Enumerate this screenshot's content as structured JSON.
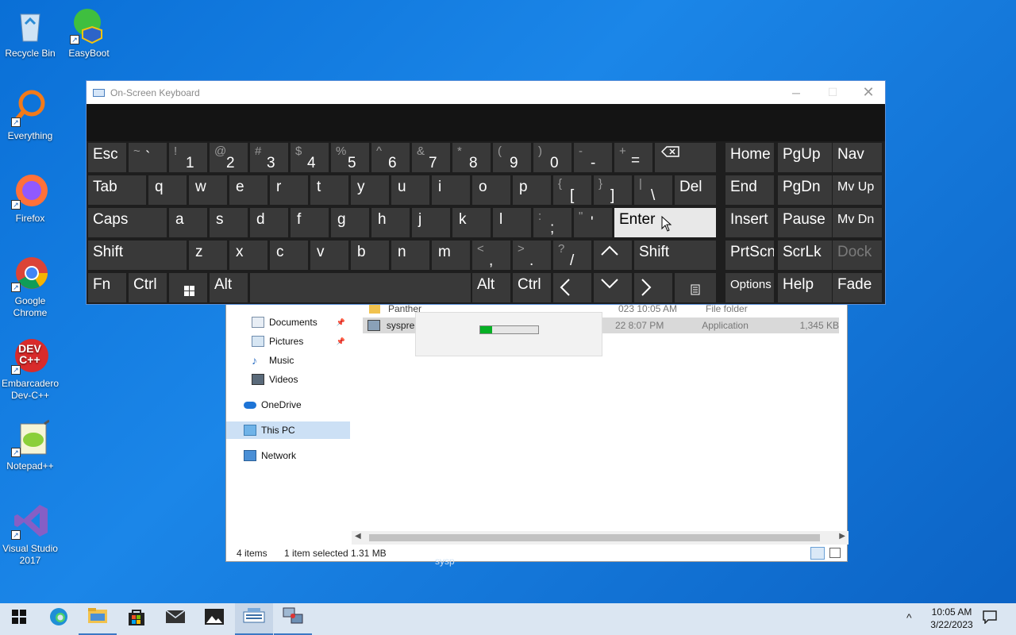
{
  "desktop": {
    "icons": [
      {
        "label": "Recycle Bin",
        "icon": "recycle-bin-icon"
      },
      {
        "label": "EasyBoot",
        "icon": "easyboot-icon"
      },
      {
        "label": "Everything",
        "icon": "everything-search-icon"
      },
      {
        "label": "Firefox",
        "icon": "firefox-icon"
      },
      {
        "label": "Google Chrome",
        "icon": "chrome-icon"
      },
      {
        "label": "Embarcadero Dev-C++",
        "icon": "devcpp-icon"
      },
      {
        "label": "Notepad++",
        "icon": "notepadpp-icon"
      },
      {
        "label": "Visual Studio 2017",
        "icon": "visual-studio-icon"
      }
    ]
  },
  "osk": {
    "title": "On-Screen Keyboard",
    "rows": {
      "r1": [
        "Esc",
        "~",
        "`",
        "!",
        "1",
        "@",
        "2",
        "#",
        "3",
        "$",
        "4",
        "%",
        "5",
        "^",
        "6",
        "&",
        "7",
        "*",
        "8",
        "(",
        "9",
        ")",
        "0",
        "-",
        "-",
        "+",
        "=",
        "Home",
        "PgUp",
        "Nav"
      ],
      "r2": [
        "Tab",
        "q",
        "w",
        "e",
        "r",
        "t",
        "y",
        "u",
        "i",
        "o",
        "p",
        "{",
        "[",
        "}",
        "]",
        "|",
        "\\",
        "Del",
        "End",
        "PgDn",
        "Mv Up"
      ],
      "r3": [
        "Caps",
        "a",
        "s",
        "d",
        "f",
        "g",
        "h",
        "j",
        "k",
        "l",
        ":",
        ";",
        "\"",
        "'",
        "Enter",
        "Insert",
        "Pause",
        "Mv Dn"
      ],
      "r4": [
        "Shift",
        "z",
        "x",
        "c",
        "v",
        "b",
        "n",
        "m",
        "<",
        ",",
        ">",
        ".",
        "?",
        "/",
        "Shift",
        "PrtScn",
        "ScrLk",
        "Dock"
      ],
      "r5": [
        "Fn",
        "Ctrl",
        "Alt",
        "Alt",
        "Ctrl",
        "Options",
        "Help",
        "Fade"
      ]
    }
  },
  "explorer": {
    "nav": [
      "Documents",
      "Pictures",
      "Music",
      "Videos",
      "OneDrive",
      "This PC",
      "Network"
    ],
    "files": [
      {
        "name": "Panther",
        "date": "023 10:05 AM",
        "type": "File folder",
        "size": ""
      },
      {
        "name": "sysprep",
        "date": "22 8:07 PM",
        "type": "Application",
        "size": "1,345 KB"
      }
    ],
    "status": {
      "items": "4 items",
      "selected": "1 item selected",
      "size": "1.31 MB"
    },
    "progress": 0.2,
    "ghost_label": "sysp"
  },
  "taskbar": {
    "time": "10:05 AM",
    "date": "3/22/2023",
    "items": [
      "start-icon",
      "edge-icon",
      "file-explorer-icon",
      "store-icon",
      "mail-icon",
      "photos-icon",
      "osk-icon",
      "sysprep-icon"
    ]
  },
  "colors": {
    "accent": "#3b78c4",
    "osk_key": "#393939",
    "osk_bg": "#1e1e1e"
  }
}
